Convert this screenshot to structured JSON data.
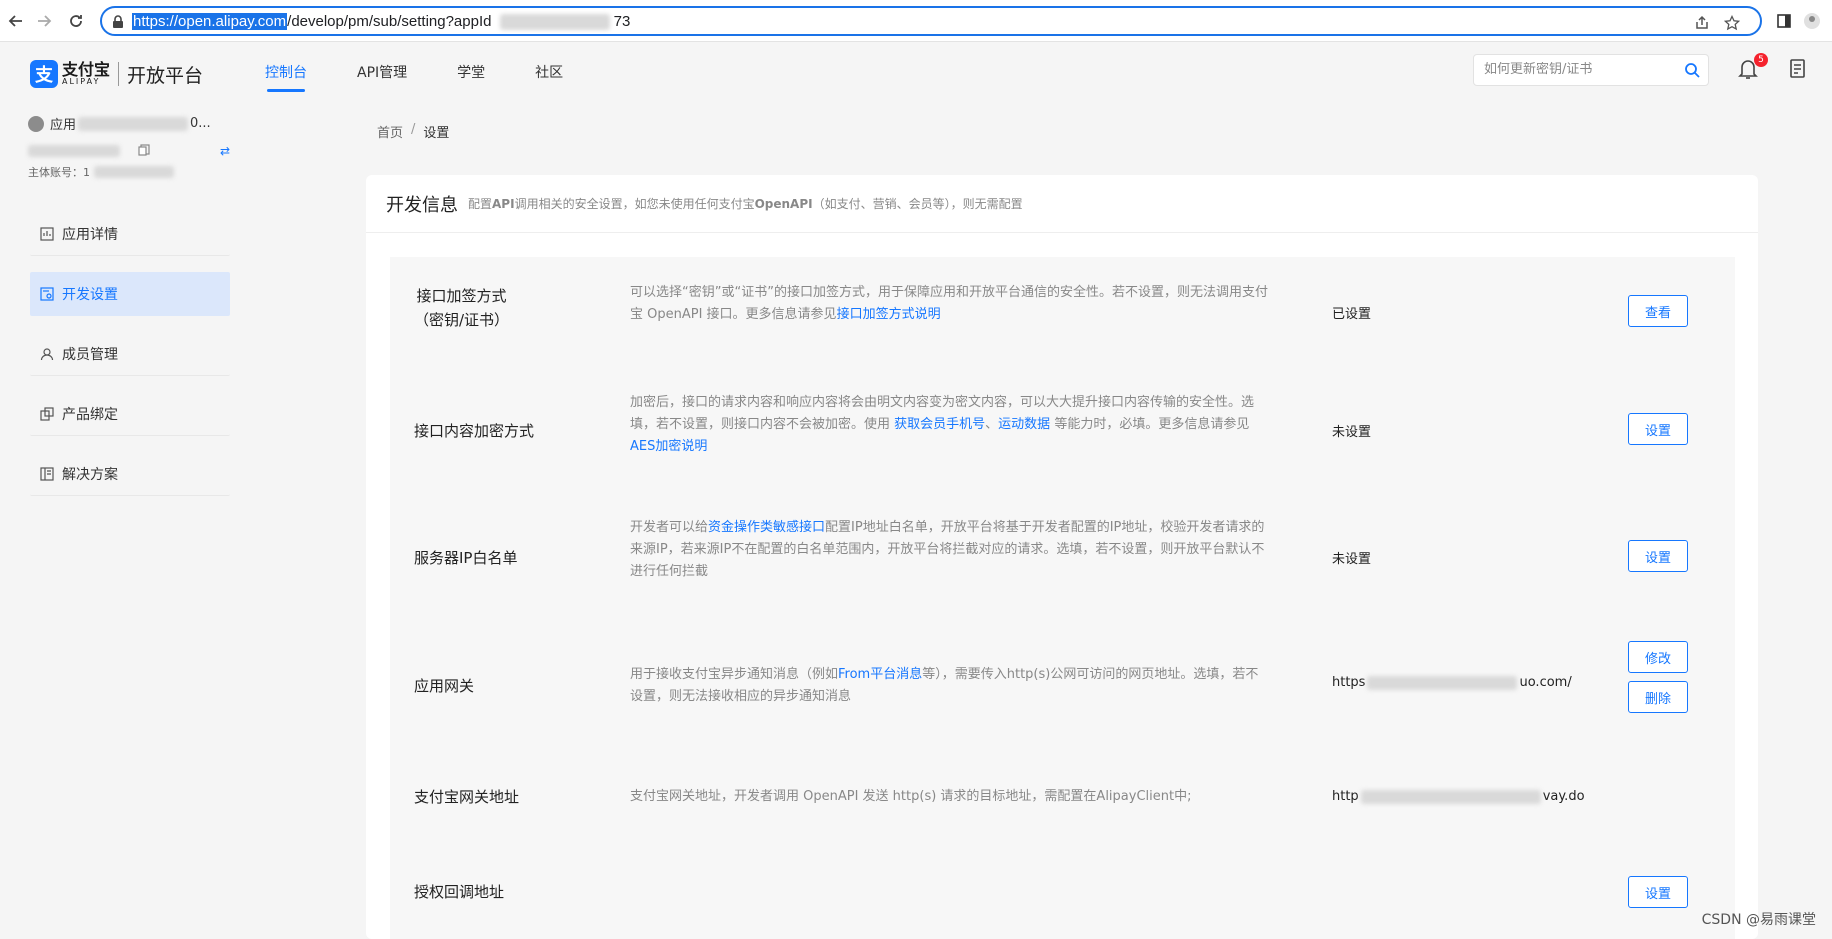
{
  "browser": {
    "url_highlight": "https://open.alipay.com",
    "url_rest": "/develop/pm/sub/setting?appId",
    "url_tail": "73"
  },
  "header": {
    "logo_cn": "支付宝",
    "logo_en": "ALIPAY",
    "platform": "开放平台",
    "nav": [
      "控制台",
      "API管理",
      "学堂",
      "社区"
    ],
    "search_placeholder": "如何更新密钥/证书",
    "notification_count": "5"
  },
  "sidebar": {
    "app_name_prefix": "应用",
    "app_name_suffix": "0...",
    "main_account_label": "主体账号：1",
    "items": [
      {
        "label": "应用详情",
        "icon": "dashboard-icon"
      },
      {
        "label": "开发设置",
        "icon": "settings-icon"
      },
      {
        "label": "成员管理",
        "icon": "user-icon"
      },
      {
        "label": "产品绑定",
        "icon": "link-icon"
      },
      {
        "label": "解决方案",
        "icon": "book-icon"
      }
    ]
  },
  "breadcrumb": {
    "home": "首页",
    "sep": "/",
    "current": "设置"
  },
  "card": {
    "title": "开发信息",
    "desc_pre": "配置",
    "desc_api": "API",
    "desc_mid": "调用相关的安全设置，如您未使用任何支付宝",
    "desc_openapi": "OpenAPI",
    "desc_post": "（如支付、营销、会员等），则无需配置"
  },
  "rows": [
    {
      "label_line1": "接口加签方式",
      "label_line2": "（密钥/证书）",
      "desc_pre": "可以选择“密钥”或“证书”的接口加签方式，用于保障应用和开放平台通信的安全性。若不设置，则无法调用支付宝 OpenAPI 接口。更多信息请参见",
      "desc_link": "接口加签方式说明",
      "status": "已设置",
      "button": "查看"
    },
    {
      "label": "接口内容加密方式",
      "desc_pre": "加密后，接口的请求内容和响应内容将会由明文内容变为密文内容，可以大大提升接口内容传输的安全性。选填，若不设置，则接口内容不会被加密。使用 ",
      "desc_link1": "获取会员手机号",
      "desc_sep": "、",
      "desc_link2": "运动数据",
      "desc_mid": " 等能力时，必填。更多信息请参见",
      "desc_link3": "AES加密说明",
      "status": "未设置",
      "button": "设置"
    },
    {
      "label": "服务器IP白名单",
      "desc_pre": "开发者可以给",
      "desc_link": "资金操作类敏感接口",
      "desc_post": "配置IP地址白名单，开放平台将基于开发者配置的IP地址，校验开发者请求的来源IP，若来源IP不在配置的白名单范围内，开放平台将拦截对应的请求。选填，若不设置，则开放平台默认不进行任何拦截",
      "status": "未设置",
      "button": "设置"
    },
    {
      "label": "应用网关",
      "desc_pre": "用于接收支付宝异步通知消息（例如",
      "desc_link": "From平台消息",
      "desc_post": "等），需要传入http(s)公网可访问的网页地址。选填，若不设置，则无法接收相应的异步通知消息",
      "status_pre": "https",
      "status_post": "uo.com/",
      "button1": "修改",
      "button2": "删除"
    },
    {
      "label": "支付宝网关地址",
      "desc": "支付宝网关地址，开发者调用 OpenAPI 发送 http(s) 请求的目标地址，需配置在AlipayClient中;",
      "status_pre": "http",
      "status_post": "vay.do"
    },
    {
      "label": "授权回调地址",
      "button": "设置"
    }
  ],
  "watermark": "CSDN @易雨课堂"
}
